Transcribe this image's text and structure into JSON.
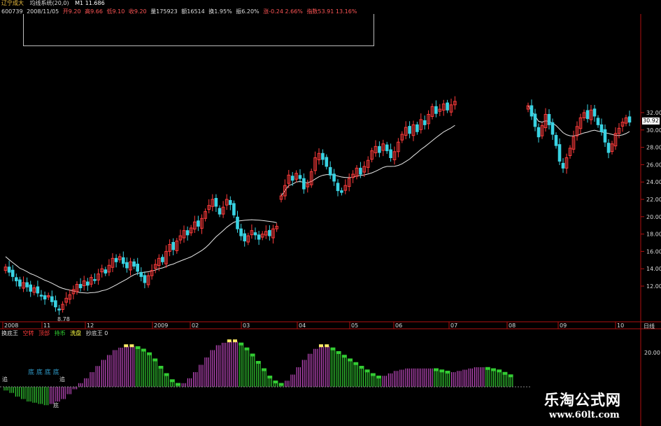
{
  "header": {
    "stock_name": "辽宁成大",
    "indicator_title": "均线系统(20,0)",
    "ma_reading": "M1 11.686",
    "code": "600739",
    "date": "2008/11/05",
    "open": "开9.20",
    "high": "高9.66",
    "low": "低9.10",
    "close": "收9.20",
    "volume": "量175923",
    "amount": "额16514",
    "change": "换1.95%",
    "amplitude": "振6.20%",
    "change_amount": "涨-0.24",
    "change_pct": "2.66%",
    "extra": "指数53.91",
    "extra2": "13.16%"
  },
  "lower_panel": {
    "title": "换底王",
    "legend": [
      {
        "label": "空转",
        "color": "#ff3b3b"
      },
      {
        "label": "顶部",
        "color": "#ff3b3b"
      },
      {
        "label": "持币",
        "color": "#33dd33"
      },
      {
        "label": "洗盘",
        "color": "#ffff44"
      },
      {
        "label": "抄底王 0",
        "color": "#dddddd"
      }
    ],
    "tags": [
      "底",
      "底",
      "底",
      "底"
    ],
    "tag_left": "追",
    "tag_mid1": "追",
    "tag_mid2": "底",
    "scale_label": "20.00"
  },
  "watermark": {
    "text": "乐淘公式网",
    "url": "www.60lt.com"
  },
  "price_label": "30.92",
  "scale_title": "日线",
  "low_marker": "8.78",
  "colors": {
    "up": "#ff3b3b",
    "down": "#39d3e3",
    "ma": "#e8e8e8",
    "axis": "#b01010",
    "histo_up": "#c04ac0",
    "histo_down": "#33cc33",
    "histo_top": "#ffee66"
  },
  "chart_data": {
    "type": "candlestick",
    "title": "辽宁成大",
    "x_ticks": [
      "2008",
      "11",
      "12",
      "2009",
      "02",
      "03",
      "04",
      "05",
      "06",
      "07",
      "08",
      "09",
      "10"
    ],
    "y_ticks": [
      12,
      14,
      16,
      18,
      20,
      22,
      24,
      26,
      28,
      30,
      32
    ],
    "ylim": [
      9,
      33
    ],
    "ma_period": 20,
    "segments": [
      {
        "name": "first",
        "closes": [
          14.2,
          13.6,
          13.1,
          12.6,
          12.0,
          12.4,
          11.9,
          11.4,
          11.8,
          11.2,
          10.9,
          10.5,
          10.9,
          10.2,
          9.6,
          9.3,
          9.9,
          10.6,
          11.0,
          11.6,
          12.2,
          11.8,
          12.6,
          12.1,
          13.0,
          12.7,
          13.4,
          14.0,
          13.5,
          14.4,
          15.2,
          14.8,
          15.4,
          14.6,
          14.1,
          14.8,
          14.3,
          13.7,
          13.1,
          12.4,
          13.2,
          13.8,
          14.5,
          15.2,
          14.8,
          16.0,
          16.8,
          16.2,
          17.2,
          17.8,
          18.4,
          17.9,
          18.7,
          19.4,
          18.9,
          19.8,
          20.6,
          21.3,
          22.0,
          21.2,
          20.3,
          21.1,
          22.0,
          21.4,
          20.2,
          18.6,
          17.8,
          17.2,
          17.8,
          18.4,
          17.9,
          17.4,
          18.0,
          18.3,
          17.8,
          18.6,
          18.9
        ]
      },
      {
        "name": "second",
        "closes": [
          22.4,
          23.6,
          24.8,
          24.2,
          25.0,
          24.4,
          23.2,
          23.8,
          25.2,
          26.8,
          27.3,
          26.6,
          25.8,
          24.8,
          24.1,
          23.0,
          22.8,
          23.6,
          24.4,
          24.9,
          25.6,
          24.9,
          25.8,
          26.5,
          27.6,
          28.1,
          27.4,
          28.4,
          27.6,
          26.8,
          27.5,
          28.6,
          29.5,
          30.3,
          29.6,
          30.6,
          29.8,
          31.2,
          30.6,
          31.8,
          32.7,
          31.9,
          32.4,
          33.0,
          32.3,
          32.9,
          33.3
        ]
      },
      {
        "name": "third",
        "closes": [
          32.8,
          31.6,
          30.4,
          29.2,
          30.5,
          31.8,
          30.6,
          29.5,
          28.2,
          26.4,
          25.6,
          26.8,
          27.9,
          29.2,
          30.4,
          31.4,
          32.0,
          31.3,
          32.3,
          31.6,
          30.6,
          29.8,
          28.6,
          27.4,
          28.4,
          29.6,
          30.2,
          30.9,
          31.4,
          30.9
        ]
      }
    ],
    "histogram": {
      "type": "bar",
      "values": [
        -3,
        -5,
        -8,
        -10,
        -12,
        -13,
        -14,
        -15,
        -14,
        -12,
        -10,
        -6,
        -2,
        3,
        7,
        12,
        17,
        22,
        26,
        30,
        32,
        33,
        33,
        32,
        30,
        27,
        22,
        16,
        10,
        5,
        2,
        3,
        7,
        12,
        18,
        24,
        30,
        34,
        36,
        37,
        37,
        35,
        31,
        26,
        20,
        14,
        8,
        4,
        2,
        5,
        10,
        16,
        22,
        27,
        31,
        33,
        33,
        31,
        28,
        25,
        22,
        19,
        16,
        13,
        10,
        8,
        9,
        11,
        13,
        14,
        15,
        15,
        15,
        15,
        15,
        14,
        13,
        12,
        12,
        13,
        14,
        15,
        16,
        16,
        15,
        14,
        13,
        11,
        9
      ]
    }
  }
}
